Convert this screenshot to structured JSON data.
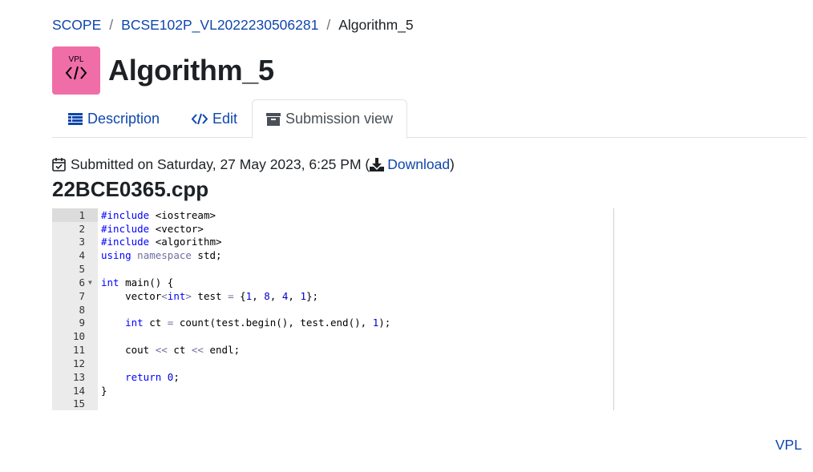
{
  "breadcrumb": {
    "items": [
      "SCOPE",
      "BCSE102P_VL2022230506281"
    ],
    "current": "Algorithm_5",
    "separator": "/"
  },
  "header": {
    "icon_text": "VPL",
    "title": "Algorithm_5"
  },
  "tabs": [
    {
      "label": "Description",
      "icon": "list-icon"
    },
    {
      "label": "Edit",
      "icon": "code-icon"
    },
    {
      "label": "Submission view",
      "icon": "archive-icon",
      "active": true
    }
  ],
  "submission": {
    "text": "Submitted on Saturday, 27 May 2023, 6:25 PM (",
    "download_label": "Download",
    "close_paren": ")"
  },
  "file": {
    "name": "22BCE0365.cpp"
  },
  "code_lines": [
    "#include <iostream>",
    "#include <vector>",
    "#include <algorithm>",
    "using namespace std;",
    "",
    "int main() {",
    "    vector<int> test = {1, 8, 4, 1};",
    "",
    "    int ct = count(test.begin(), test.end(), 1);",
    "",
    "    cout << ct << endl;",
    "",
    "    return 0;",
    "}",
    ""
  ],
  "footer": {
    "link": "VPL"
  },
  "colors": {
    "link": "#0f47ad",
    "activity_icon_bg": "#f06ea8",
    "gutter_bg": "#ebebeb"
  }
}
